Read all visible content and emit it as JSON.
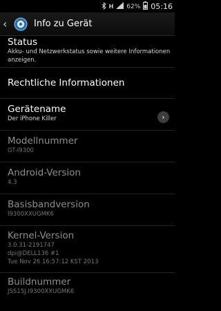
{
  "status_bar": {
    "battery_percent": "62%",
    "time": "05:16",
    "icons": [
      "bluetooth-icon",
      "network-h-icon",
      "signal-icon",
      "battery-icon"
    ]
  },
  "action_bar": {
    "title": "Info zu Gerät",
    "icon": "gear-icon"
  },
  "items": [
    {
      "title": "Status",
      "subtitle": "Akku- und Netzwerkstatus sowie weitere Informationen anzeigen.",
      "enabled": true
    },
    {
      "title": "Rechtliche Informationen",
      "enabled": true
    },
    {
      "title": "Gerätename",
      "subtitle": "Der iPhone Killer",
      "enabled": true,
      "has_chevron": true
    },
    {
      "title": "Modellnummer",
      "subtitle": "GT-I9300",
      "enabled": false
    },
    {
      "title": "Android-Version",
      "subtitle": "4.3",
      "enabled": false
    },
    {
      "title": "Basisbandversion",
      "subtitle": "I9300XXUGMK6",
      "enabled": false
    },
    {
      "title": "Kernel-Version",
      "subtitle": "3.0.31-2191747\ndpi@DELL136 #1\nTue Nov 26 16:57:12 KST 2013",
      "enabled": false
    },
    {
      "title": "Buildnummer",
      "subtitle": "JSS15J.I9300XXUGMK6",
      "enabled": false
    }
  ],
  "colors": {
    "background": "#000000",
    "enabled_text": "#ffffff",
    "disabled_text": "#8e8e8e"
  }
}
